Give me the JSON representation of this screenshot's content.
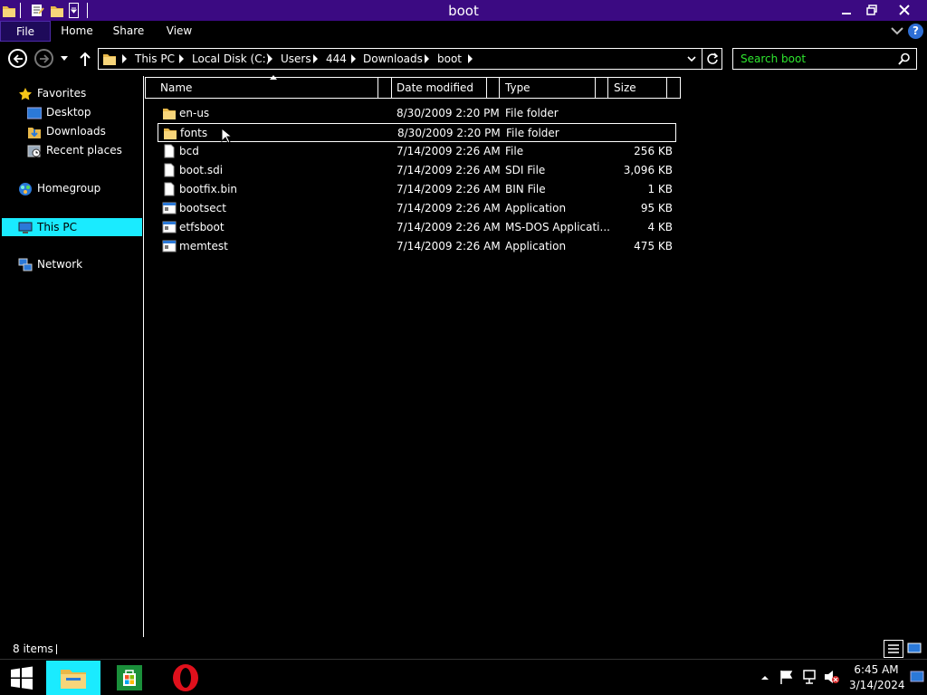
{
  "window": {
    "title": "boot"
  },
  "ribbon": {
    "tabs": [
      "File",
      "Home",
      "Share",
      "View"
    ],
    "help": "?"
  },
  "address": {
    "crumbs": [
      "This PC",
      "Local Disk (C:)",
      "Users",
      "444",
      "Downloads",
      "boot"
    ]
  },
  "search": {
    "placeholder": "Search boot"
  },
  "nav": {
    "favorites": "Favorites",
    "desktop": "Desktop",
    "downloads": "Downloads",
    "recent": "Recent places",
    "homegroup": "Homegroup",
    "thispc": "This PC",
    "network": "Network"
  },
  "columns": {
    "name": "Name",
    "date": "Date modified",
    "type": "Type",
    "size": "Size"
  },
  "files": [
    {
      "name": "en-us",
      "date": "8/30/2009 2:20 PM",
      "type": "File folder",
      "size": "",
      "icon": "folder-icon"
    },
    {
      "name": "fonts",
      "date": "8/30/2009 2:20 PM",
      "type": "File folder",
      "size": "",
      "icon": "folder-icon"
    },
    {
      "name": "bcd",
      "date": "7/14/2009 2:26 AM",
      "type": "File",
      "size": "256 KB",
      "icon": "file-icon"
    },
    {
      "name": "boot.sdi",
      "date": "7/14/2009 2:26 AM",
      "type": "SDI File",
      "size": "3,096 KB",
      "icon": "file-icon"
    },
    {
      "name": "bootfix.bin",
      "date": "7/14/2009 2:26 AM",
      "type": "BIN File",
      "size": "1 KB",
      "icon": "file-icon"
    },
    {
      "name": "bootsect",
      "date": "7/14/2009 2:26 AM",
      "type": "Application",
      "size": "95 KB",
      "icon": "app-icon"
    },
    {
      "name": "etfsboot",
      "date": "7/14/2009 2:26 AM",
      "type": "MS-DOS Applicati...",
      "size": "4 KB",
      "icon": "app-icon"
    },
    {
      "name": "memtest",
      "date": "7/14/2009 2:26 AM",
      "type": "Application",
      "size": "475 KB",
      "icon": "app-icon"
    }
  ],
  "status": {
    "items": "8 items"
  },
  "taskbar": {
    "time": "6:45 AM",
    "date": "3/14/2024"
  },
  "colors": {
    "titlebar": "#3b0a82",
    "selection": "#1aebff",
    "search_text": "#2ee62e",
    "folder": "#e8b84a"
  }
}
